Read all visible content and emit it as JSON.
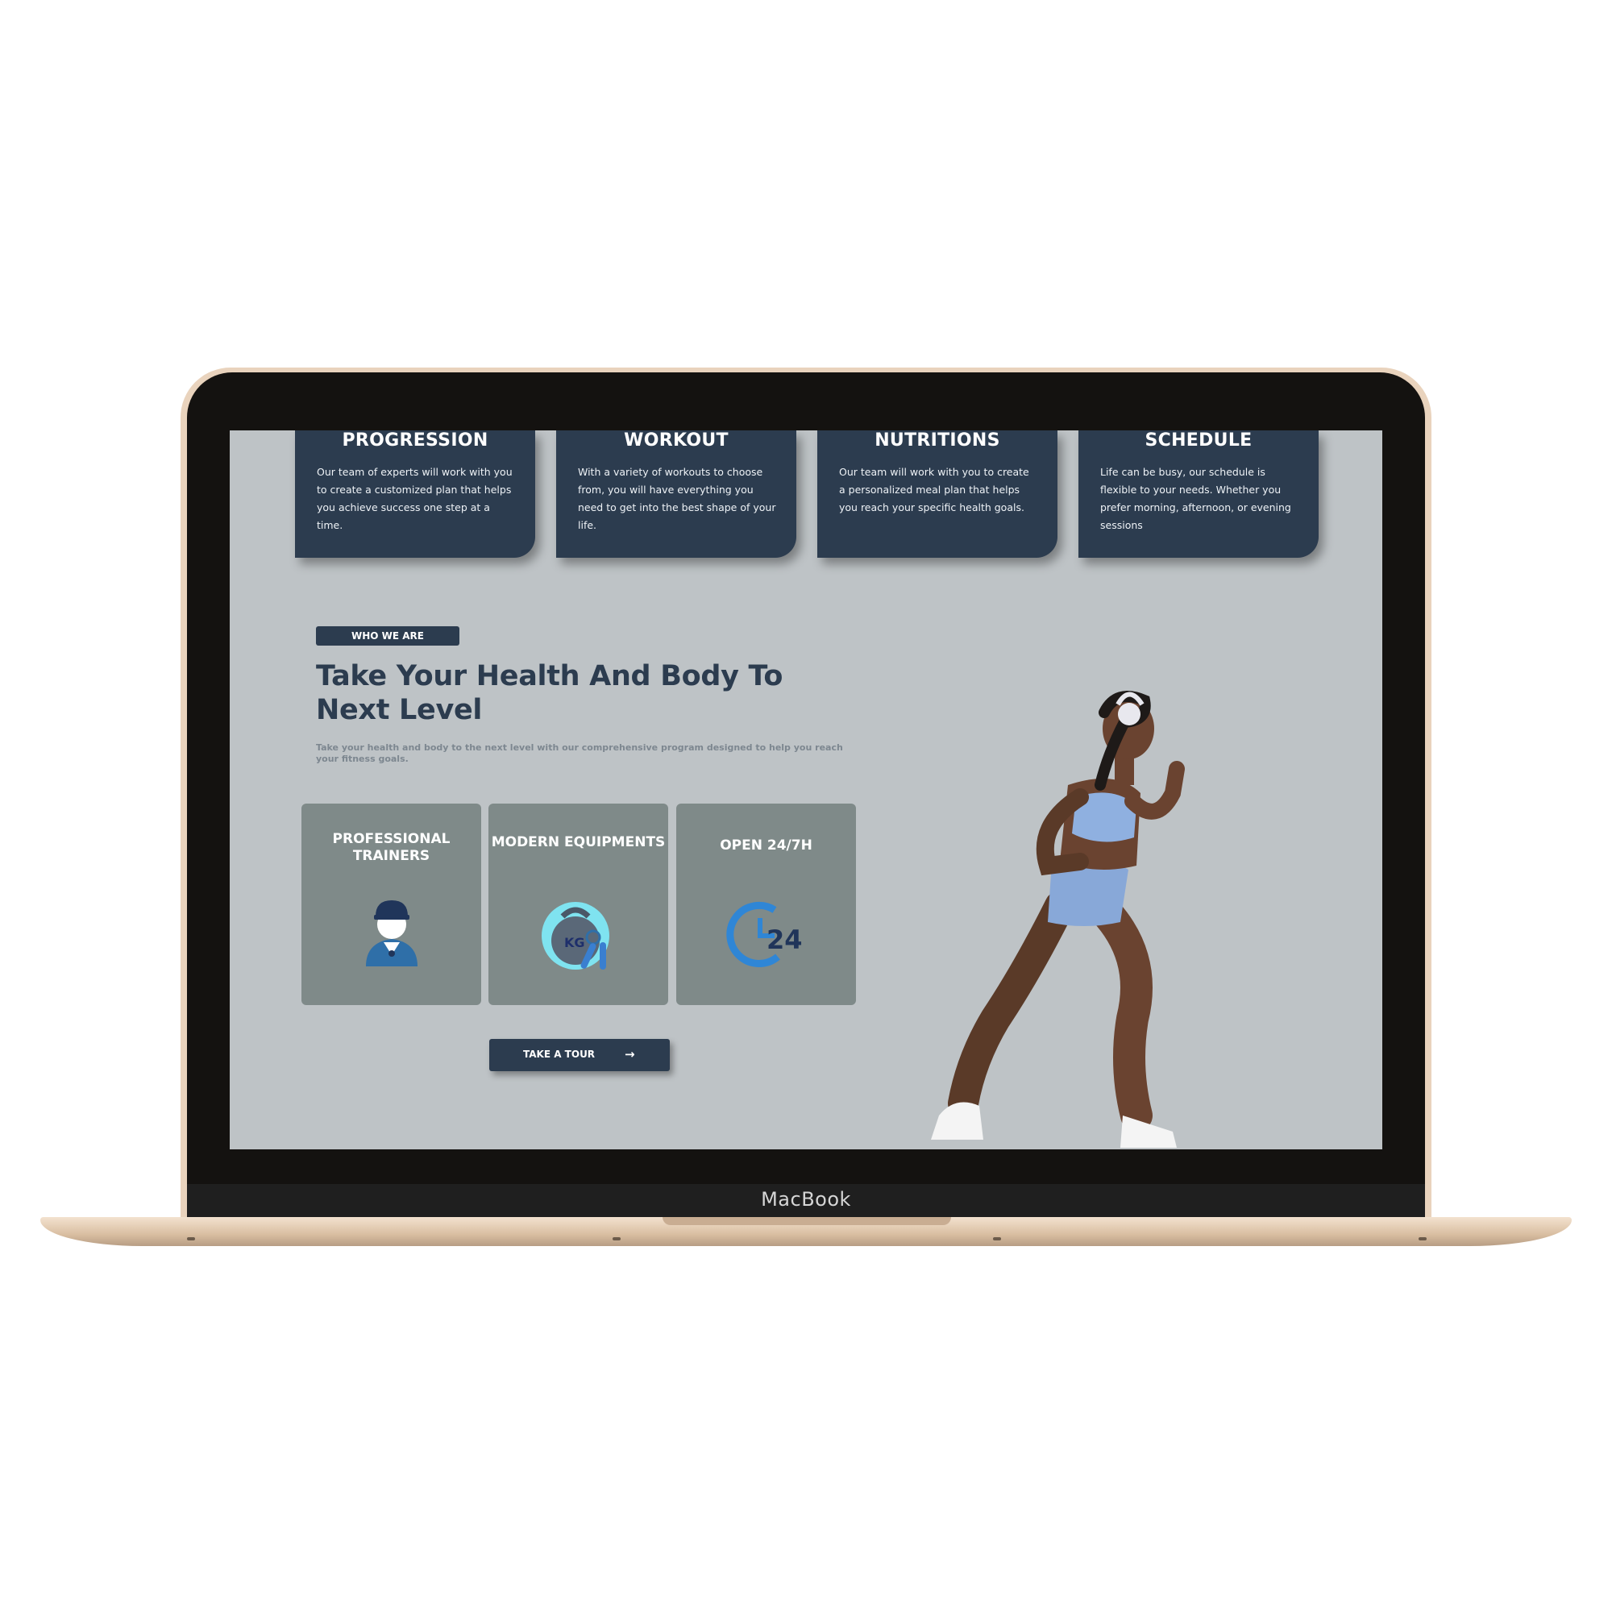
{
  "device": {
    "brand": "MacBook"
  },
  "features": [
    {
      "title": "PROGRESSION",
      "description": "Our team of experts will work with you to create a customized plan that helps you achieve success one step at a time."
    },
    {
      "title": "WORKOUT",
      "description": "With a variety of workouts to choose from, you will have everything you need to get into the best shape of your life."
    },
    {
      "title": "NUTRITIONS",
      "description": "Our team will work with you to create a personalized meal plan that helps you reach your specific health goals."
    },
    {
      "title": "SCHEDULE",
      "description": "Life can be busy, our schedule is flexible to your needs. Whether you prefer morning, afternoon, or evening sessions"
    }
  ],
  "about": {
    "badge": "WHO WE ARE",
    "headline": "Take Your Health And Body To Next Level",
    "subtext": "Take your health and body to the next level with our comprehensive program designed to help you reach your fitness goals."
  },
  "stats": [
    {
      "label": "PROFESSIONAL TRAINERS",
      "icon": "trainer-icon"
    },
    {
      "label": "MODERN EQUIPMENTS",
      "icon": "kettlebell-icon",
      "icon_text": "KG"
    },
    {
      "label": "OPEN 24/7H",
      "icon": "clock-24-icon",
      "icon_text": "24"
    }
  ],
  "cta": {
    "label": "TAKE A TOUR",
    "arrow": "→"
  },
  "colors": {
    "navy": "#2c3c4f",
    "screen_bg": "#bec3c6",
    "stat_card": "#7f8a89",
    "gold": "#e9d3bd"
  }
}
